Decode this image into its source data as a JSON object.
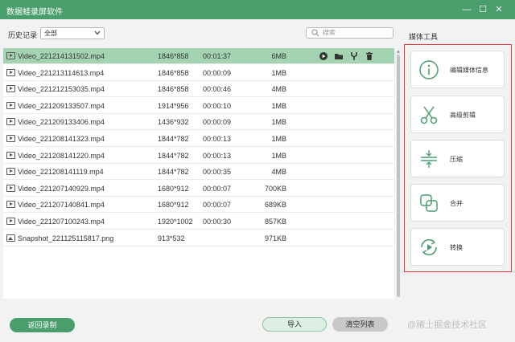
{
  "app": {
    "title": "数据蛙录屏软件",
    "minimize": "—",
    "maximize": "☐",
    "close": "✕"
  },
  "toolbar": {
    "history_label": "历史记录",
    "filter_value": "全部",
    "search_placeholder": "搜索"
  },
  "files": [
    {
      "name": "Video_221214131502.mp4",
      "resolution": "1846*858",
      "duration": "00:01:37",
      "size": "6MB",
      "type": "video",
      "selected": true
    },
    {
      "name": "Video_221213114613.mp4",
      "resolution": "1846*858",
      "duration": "00:00:09",
      "size": "1MB",
      "type": "video"
    },
    {
      "name": "Video_221212153035.mp4",
      "resolution": "1846*858",
      "duration": "00:00:46",
      "size": "4MB",
      "type": "video"
    },
    {
      "name": "Video_221209133507.mp4",
      "resolution": "1914*956",
      "duration": "00:00:10",
      "size": "1MB",
      "type": "video"
    },
    {
      "name": "Video_221209133406.mp4",
      "resolution": "1436*932",
      "duration": "00:00:09",
      "size": "1MB",
      "type": "video"
    },
    {
      "name": "Video_221208141323.mp4",
      "resolution": "1844*782",
      "duration": "00:00:13",
      "size": "1MB",
      "type": "video"
    },
    {
      "name": "Video_221208141220.mp4",
      "resolution": "1844*782",
      "duration": "00:00:13",
      "size": "1MB",
      "type": "video"
    },
    {
      "name": "Video_221208141119.mp4",
      "resolution": "1844*782",
      "duration": "00:00:35",
      "size": "4MB",
      "type": "video"
    },
    {
      "name": "Video_221207140929.mp4",
      "resolution": "1680*912",
      "duration": "00:00:07",
      "size": "700KB",
      "type": "video"
    },
    {
      "name": "Video_221207140841.mp4",
      "resolution": "1680*912",
      "duration": "00:00:07",
      "size": "689KB",
      "type": "video"
    },
    {
      "name": "Video_221207100243.mp4",
      "resolution": "1920*1002",
      "duration": "00:00:30",
      "size": "857KB",
      "type": "video"
    },
    {
      "name": "Snapshot_221125115817.png",
      "resolution": "913*532",
      "duration": "",
      "size": "971KB",
      "type": "image"
    }
  ],
  "row_actions": [
    "play-icon",
    "folder-icon",
    "edit-icon",
    "trash-icon"
  ],
  "media_tools": {
    "title": "媒体工具",
    "items": [
      {
        "label": "编辑媒体信息",
        "icon": "info-icon"
      },
      {
        "label": "高级剪辑",
        "icon": "scissors-icon"
      },
      {
        "label": "压缩",
        "icon": "compress-icon"
      },
      {
        "label": "合并",
        "icon": "merge-icon"
      },
      {
        "label": "转换",
        "icon": "convert-icon"
      }
    ]
  },
  "footer": {
    "back_label": "返回录制",
    "import_label": "导入",
    "clear_label": "清空列表",
    "watermark": "@稀土掘金技术社区"
  },
  "colors": {
    "brand": "#4a9e6b",
    "selected_row": "#a3d3b1",
    "highlight_border": "#e03c3c"
  }
}
